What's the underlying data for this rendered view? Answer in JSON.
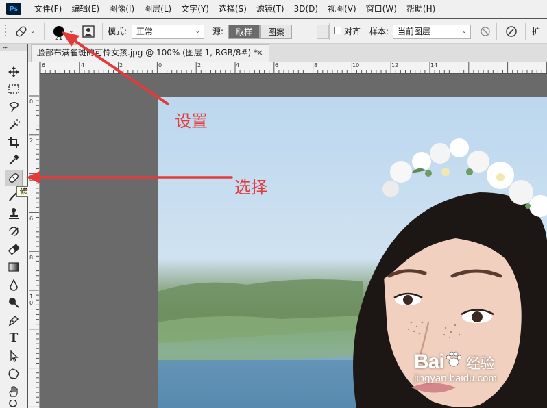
{
  "app": {
    "logo": "Ps"
  },
  "menu": [
    "文件(F)",
    "编辑(E)",
    "图像(I)",
    "图层(L)",
    "文字(Y)",
    "选择(S)",
    "滤镜(T)",
    "3D(D)",
    "视图(V)",
    "窗口(W)",
    "帮助(H)"
  ],
  "options": {
    "brush_size": "21",
    "mode_label": "模式:",
    "mode_value": "正常",
    "source_label": "源:",
    "source_sampled": "取样",
    "source_pattern": "图案",
    "aligned_label": "对齐",
    "sample_label": "样本:",
    "sample_value": "当前图层",
    "diffusion_label": "扩散"
  },
  "tools": {
    "active_tooltip": "修复画笔工具 (J)",
    "icons": [
      "move-icon",
      "marquee-icon",
      "lasso-icon",
      "magic-wand-icon",
      "crop-icon",
      "eyedropper-icon",
      "healing-brush-icon",
      "brush-icon",
      "clone-stamp-icon",
      "history-brush-icon",
      "eraser-icon",
      "gradient-icon",
      "blur-icon",
      "dodge-icon",
      "pen-icon",
      "type-icon",
      "path-selection-icon",
      "shape-icon",
      "hand-icon",
      "zoom-icon"
    ]
  },
  "document": {
    "tab_title": "脸部布满雀斑的可怜女孩.jpg @ 100% (图层 1, RGB/8#) *",
    "close_symbol": "×"
  },
  "rulers": {
    "top_labels": [
      "6",
      "4",
      "2",
      "0",
      "2",
      "4",
      "6",
      "8",
      "10",
      "12",
      "14"
    ],
    "left_labels": [
      "0",
      "2",
      "4",
      "6",
      "8",
      "1",
      "0"
    ]
  },
  "annotations": {
    "settings_label": "设置",
    "select_label": "选择",
    "arrow_color": "#e23b3b"
  },
  "watermark": {
    "logo": "Bai",
    "brand": "经验",
    "url": "jingyan.baidu.com"
  }
}
